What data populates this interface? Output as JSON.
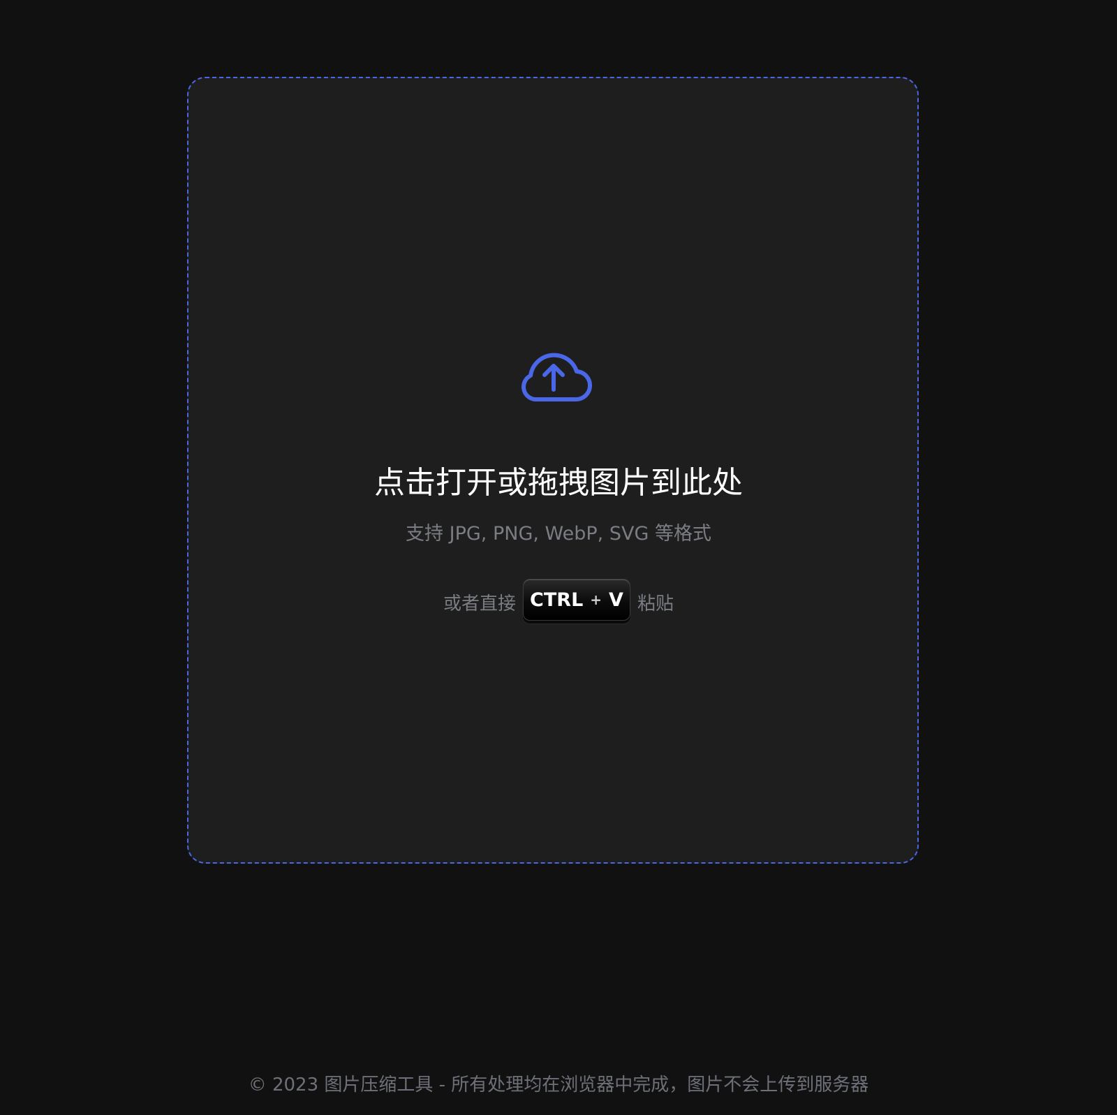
{
  "dropzone": {
    "icon": "cloud-upload-icon",
    "title": "点击打开或拖拽图片到此处",
    "formats": "支持 JPG, PNG, WebP, SVG 等格式",
    "paste_prefix": "或者直接",
    "shortcut_ctrl": "CTRL",
    "shortcut_plus": "+",
    "shortcut_key": "V",
    "paste_suffix": "粘贴"
  },
  "footer": {
    "text": "© 2023 图片压缩工具 - 所有处理均在浏览器中完成，图片不会上传到服务器"
  },
  "colors": {
    "background": "#111111",
    "panel": "#1e1e1e",
    "accent": "#4a67e8",
    "muted_text": "#7a7d84"
  }
}
